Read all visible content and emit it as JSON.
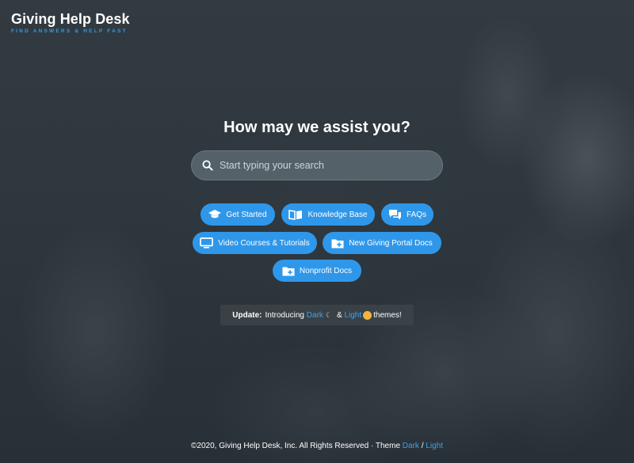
{
  "brand": {
    "title": "Giving Help Desk",
    "tagline": "FIND ANSWERS & HELP FAST"
  },
  "hero": {
    "title": "How may we assist you?"
  },
  "search": {
    "placeholder": "Start typing your search",
    "value": ""
  },
  "buttons": [
    {
      "label": "Get Started",
      "icon": "graduation-cap-icon"
    },
    {
      "label": "Knowledge Base",
      "icon": "book-icon"
    },
    {
      "label": "FAQs",
      "icon": "chat-bubbles-icon"
    },
    {
      "label": "Video Courses & Tutorials",
      "icon": "monitor-icon"
    },
    {
      "label": "New Giving Portal Docs",
      "icon": "folder-plus-icon"
    },
    {
      "label": "Nonprofit Docs",
      "icon": "folder-plus-icon"
    }
  ],
  "update": {
    "prefix": "Update:",
    "text": "Introducing",
    "dark": "Dark",
    "amp": "&",
    "light": "Light",
    "suffix": "themes!"
  },
  "footer": {
    "copyright": "©2020, Giving Help Desk, Inc. All Rights Reserved · Theme",
    "dark": "Dark",
    "sep": "/",
    "light": "Light"
  },
  "colors": {
    "accent": "#2f97ea",
    "link": "#3ba3f0",
    "background": "#2b3339"
  }
}
